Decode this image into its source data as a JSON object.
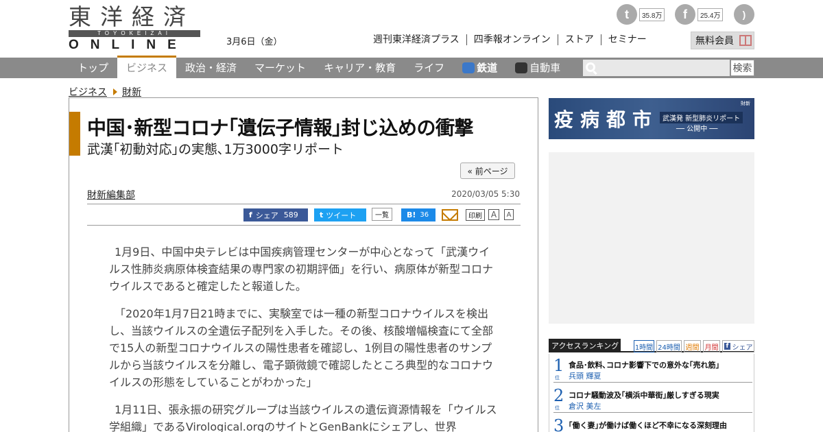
{
  "header": {
    "logo_top": "東洋経済",
    "logo_middle": "TOYOKEIZAI",
    "logo_bottom": "ONLINE",
    "date": "3月6日（金）",
    "social": [
      {
        "icon": "twitter-icon",
        "count": "35.8万"
      },
      {
        "icon": "facebook-icon",
        "count": "25.4万"
      },
      {
        "icon": "rss-icon",
        "count": ""
      }
    ],
    "links": [
      "週刊東洋経済プラス",
      "四季報オンライン",
      "ストア",
      "セミナー"
    ],
    "member_label": "無料会員"
  },
  "nav": {
    "items": [
      {
        "label": "トップ",
        "active": false
      },
      {
        "label": "ビジネス",
        "active": true
      },
      {
        "label": "政治・経済",
        "active": false
      },
      {
        "label": "マーケット",
        "active": false
      },
      {
        "label": "キャリア・教育",
        "active": false
      },
      {
        "label": "ライフ",
        "active": false
      },
      {
        "label": "鉄道",
        "active": false
      },
      {
        "label": "自動車",
        "active": false
      }
    ],
    "search_button": "検索"
  },
  "breadcrumb": [
    "ビジネス",
    "財新"
  ],
  "article": {
    "title": "中国･新型コロナ｢遺伝子情報｣封じ込めの衝撃",
    "subtitle": "武漢｢初動対応｣の実態､1万3000字リポート",
    "prev_page": "« 前ページ",
    "author": "財新編集部",
    "datetime": "2020/03/05 5:30",
    "share": {
      "facebook_label": "シェア",
      "facebook_count": "589",
      "twitter_label": "ツイート",
      "list_label": "一覧",
      "hatena_label": "B!",
      "hatena_count": "36",
      "print_label": "印刷",
      "font_large": "A",
      "font_small": "A"
    },
    "paragraphs": [
      "1月9日、中国中央テレビは中国疾病管理センターが中心となって「武漢ウイルス性肺炎病原体検査結果の専門家の初期評価」を行い、病原体が新型コロナウイルスであると確定したと報道した。",
      "「2020年1月7日21時までに、実験室では一種の新型コロナウイルスを検出し、当該ウイルスの全遺伝子配列を入手した。その後、核酸増幅検査にて全部で15人の新型コロナウイルスの陽性患者を確認し、1例目の陽性患者のサンプルから当該ウイルスを分離し、電子顕微鏡で確認したところ典型的なコロナウイルスの形態をしていることがわかった」",
      "1月11日、張永振の研究グループは当該ウイルスの遺伝資源情報を「ウイルス学組織」であるVirological.orgのサイトとGenBankにシェアし、世界"
    ]
  },
  "banner": {
    "title": "疫病都市",
    "sub": "武漢発 新型肺炎リポート",
    "status": "── 公開中 ──",
    "publisher": "財新"
  },
  "ranking": {
    "label": "アクセスランキング",
    "tabs": [
      "1時間",
      "24時間",
      "週間",
      "月間",
      "シェア"
    ],
    "items": [
      {
        "num": "1",
        "suffix": "位",
        "title": "食品･飲料､コロナ影響下での意外な｢売れ筋｣",
        "author": "兵頭 輝夏"
      },
      {
        "num": "2",
        "suffix": "位",
        "title": "コロナ騒動波及｢横浜中華街｣厳しすぎる現実",
        "author": "倉沢 美左"
      },
      {
        "num": "3",
        "suffix": "位",
        "title": "｢働く妻｣が働けば働くほど不幸になる深刻理由",
        "author": ""
      }
    ]
  }
}
